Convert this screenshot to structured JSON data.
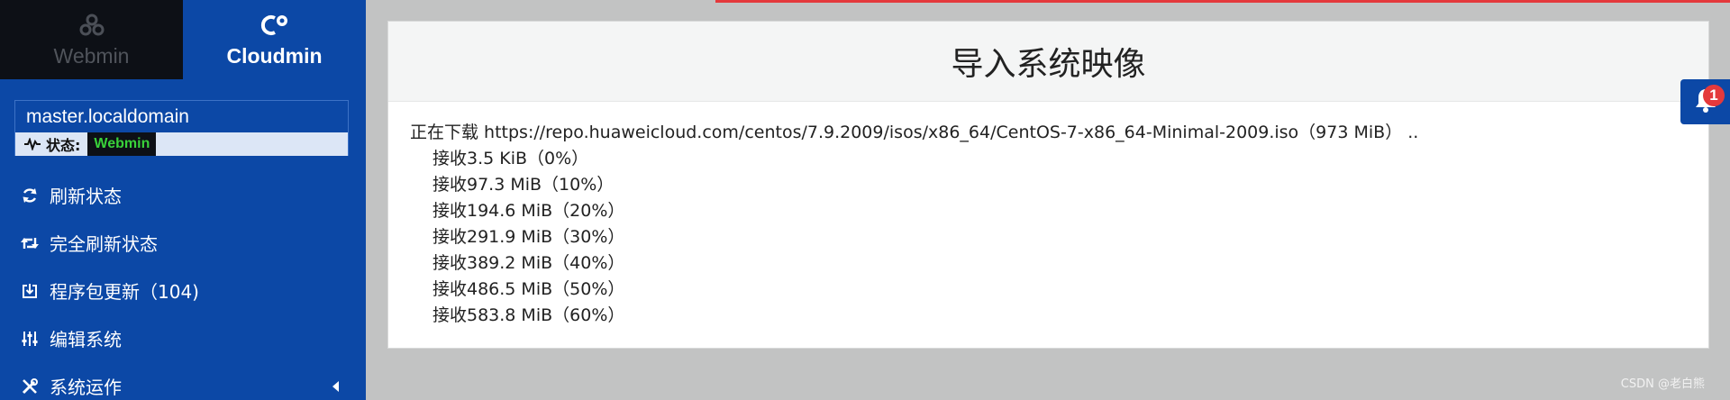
{
  "product_switcher": {
    "webmin_label": "Webmin",
    "cloudmin_label": "Cloudmin",
    "webmin_icon": "webmin-logo-icon",
    "cloudmin_icon": "cloudmin-logo-icon"
  },
  "host": {
    "name": "master.localdomain",
    "status_label": "状态:",
    "status_value": "Webmin"
  },
  "menu": {
    "items": [
      {
        "label": "刷新状态",
        "icon": "refresh-icon"
      },
      {
        "label": "完全刷新状态",
        "icon": "retweet-icon"
      },
      {
        "label": "程序包更新（104)",
        "icon": "download-box-icon"
      },
      {
        "label": "编辑系统",
        "icon": "sliders-icon"
      },
      {
        "label": "系统运作",
        "icon": "tools-icon"
      }
    ]
  },
  "panel": {
    "title": "导入系统映像",
    "log": [
      "正在下载 https://repo.huaweicloud.com/centos/7.9.2009/isos/x86_64/CentOS-7-x86_64-Minimal-2009.iso（973 MiB） ..",
      "接收3.5 KiB（0%）",
      "接收97.3 MiB（10%）",
      "接收194.6 MiB（20%）",
      "接收291.9 MiB（30%）",
      "接收389.2 MiB（40%）",
      "接收486.5 MiB（50%）",
      "接收583.8 MiB（60%）"
    ]
  },
  "notifications": {
    "count": "1",
    "icon": "bell-icon"
  },
  "watermark": "CSDN @老白熊",
  "colors": {
    "sidebar_bg": "#0c48a6",
    "webmin_tab_bg": "#0d1016",
    "status_green": "#39d23a",
    "accent_red": "#e4393c",
    "page_bg": "#c2c3c3"
  }
}
